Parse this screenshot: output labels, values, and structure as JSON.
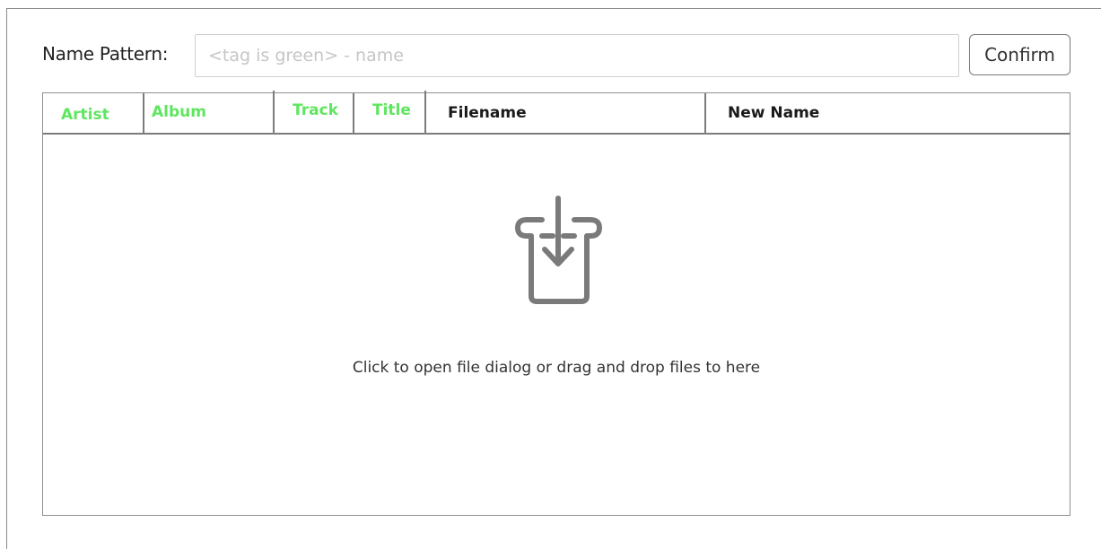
{
  "toolbar": {
    "pattern_label": "Name Pattern:",
    "pattern_value": "",
    "pattern_placeholder": "<tag is green> - name",
    "confirm_label": "Confirm"
  },
  "table": {
    "columns": [
      {
        "label": "Artist",
        "is_tag": true
      },
      {
        "label": "Album",
        "is_tag": true
      },
      {
        "label": "Track",
        "is_tag": true
      },
      {
        "label": "Title",
        "is_tag": true
      },
      {
        "label": "Filename",
        "is_tag": false
      },
      {
        "label": "New Name",
        "is_tag": false
      }
    ],
    "rows": []
  },
  "drop_zone": {
    "icon": "inbox-download-icon",
    "message": "Click to open file dialog or drag and drop files to here"
  },
  "colors": {
    "tag_header": "#5fe65f",
    "border": "#8f8f8f",
    "icon": "#7a7a7a"
  }
}
